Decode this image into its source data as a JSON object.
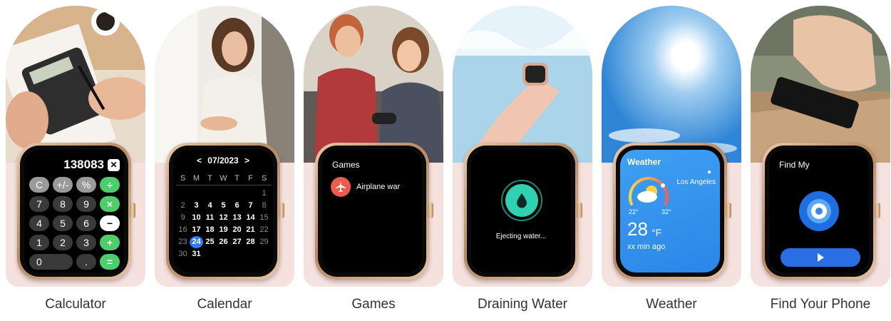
{
  "captions": [
    "Calculator",
    "Calendar",
    "Games",
    "Draining Water",
    "Weather",
    "Find Your Phone"
  ],
  "calculator": {
    "value": "138083",
    "clear_key": "✕",
    "rows": [
      [
        {
          "k": "C",
          "s": "gray"
        },
        {
          "k": "+/-",
          "s": "gray"
        },
        {
          "k": "%",
          "s": "gray"
        },
        {
          "k": "÷",
          "s": "green"
        }
      ],
      [
        {
          "k": "7",
          "s": "dark"
        },
        {
          "k": "8",
          "s": "dark"
        },
        {
          "k": "9",
          "s": "dark"
        },
        {
          "k": "×",
          "s": "green"
        }
      ],
      [
        {
          "k": "4",
          "s": "dark"
        },
        {
          "k": "5",
          "s": "dark"
        },
        {
          "k": "6",
          "s": "dark"
        },
        {
          "k": "−",
          "s": "white"
        }
      ],
      [
        {
          "k": "1",
          "s": "dark"
        },
        {
          "k": "2",
          "s": "dark"
        },
        {
          "k": "3",
          "s": "dark"
        },
        {
          "k": "+",
          "s": "green"
        }
      ],
      [
        {
          "k": "0",
          "s": "wide"
        },
        {
          "k": ".",
          "s": "dark"
        },
        {
          "k": "=",
          "s": "green"
        }
      ]
    ]
  },
  "calendar": {
    "month": "07/2023",
    "prev": "<",
    "next": ">",
    "weekdays": [
      "S",
      "M",
      "T",
      "W",
      "T",
      "F",
      "S"
    ],
    "weeks": [
      [
        "",
        "",
        "",
        "",
        "",
        "",
        "1"
      ],
      [
        "2",
        "3",
        "4",
        "5",
        "6",
        "7",
        "8"
      ],
      [
        "9",
        "10",
        "11",
        "12",
        "13",
        "14",
        "15"
      ],
      [
        "16",
        "17",
        "18",
        "19",
        "20",
        "21",
        "22"
      ],
      [
        "23",
        "24",
        "25",
        "26",
        "27",
        "28",
        "29"
      ],
      [
        "30",
        "31",
        "",
        "",
        "",
        "",
        ""
      ]
    ],
    "today": "24"
  },
  "games": {
    "title": "Games",
    "item": "Airplane war",
    "icon": "airplane-icon"
  },
  "water": {
    "label": "Ejecting water...",
    "icon": "water-drop-icon"
  },
  "weather": {
    "title": "Weather",
    "city": "Los Angeles",
    "low": "22°",
    "high": "32°",
    "temp": "28",
    "unit": "°F",
    "updated": "xx min ago",
    "icon": "partly-cloudy-icon"
  },
  "findmy": {
    "title": "Find My",
    "icon": "target-icon",
    "button_icon": "play-icon"
  },
  "colors": {
    "accent_green": "#4ccf6a",
    "water_teal": "#2fd1b3",
    "weather_blue": "#3fa0f2",
    "find_blue": "#1e6ee0",
    "base_pink": "#f5e1de"
  }
}
